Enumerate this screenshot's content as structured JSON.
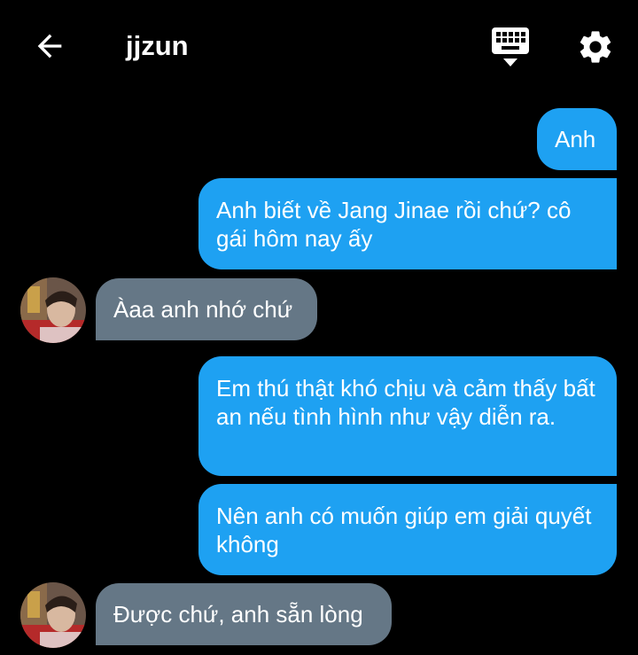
{
  "header": {
    "title": "jjzun",
    "back_icon": "arrow-left-icon",
    "keyboard_icon": "keyboard-hide-icon",
    "settings_icon": "gear-icon"
  },
  "colors": {
    "background": "#000000",
    "sent_bubble": "#1ea1f2",
    "received_bubble": "#657786",
    "text": "#ffffff"
  },
  "messages": [
    {
      "from": "me",
      "text": "Anh"
    },
    {
      "from": "me",
      "text": "Anh biết về Jang Jinae rồi chứ? cô gái hôm nay ấy"
    },
    {
      "from": "them",
      "text": "Àaa anh nhớ chứ"
    },
    {
      "from": "me",
      "text": "Em thú thật khó chịu và cảm thấy bất an nếu tình hình như vậy diễn ra."
    },
    {
      "from": "me",
      "text": "Nên anh có muốn giúp em giải quyết không"
    },
    {
      "from": "them",
      "text": "Được chứ, anh sẵn lòng"
    }
  ]
}
